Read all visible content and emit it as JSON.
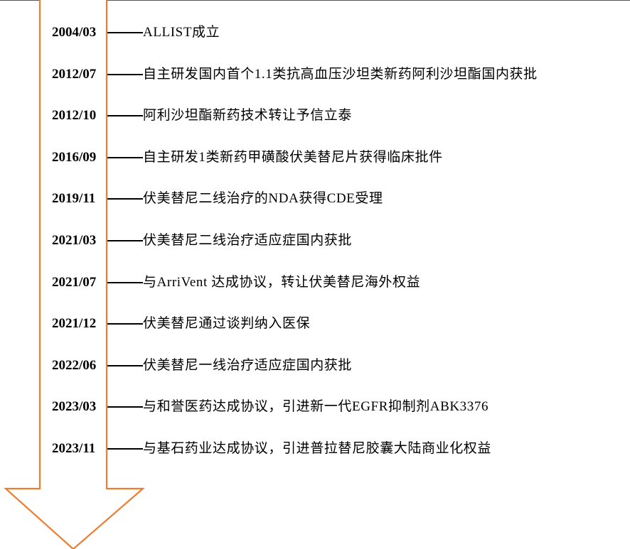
{
  "colors": {
    "arrow_stroke": "#ED7D31",
    "background": "#ffffff",
    "text": "#000000"
  },
  "timeline": {
    "events": [
      {
        "date": "2004/03",
        "description": "ALLIST成立"
      },
      {
        "date": "2012/07",
        "description": "自主研发国内首个1.1类抗高血压沙坦类新药阿利沙坦酯国内获批"
      },
      {
        "date": "2012/10",
        "description": "阿利沙坦酯新药技术转让予信立泰"
      },
      {
        "date": "2016/09",
        "description": "自主研发1类新药甲磺酸伏美替尼片获得临床批件"
      },
      {
        "date": "2019/11",
        "description": "伏美替尼二线治疗的NDA获得CDE受理"
      },
      {
        "date": "2021/03",
        "description": "伏美替尼二线治疗适应症国内获批"
      },
      {
        "date": "2021/07",
        "description": "与ArriVent 达成协议，转让伏美替尼海外权益"
      },
      {
        "date": "2021/12",
        "description": "伏美替尼通过谈判纳入医保"
      },
      {
        "date": "2022/06",
        "description": "伏美替尼一线治疗适应症国内获批"
      },
      {
        "date": "2023/03",
        "description": "与和誉医药达成协议，引进新一代EGFR抑制剂ABK3376"
      },
      {
        "date": "2023/11",
        "description": "与基石药业达成协议，引进普拉替尼胶囊大陆商业化权益"
      }
    ]
  }
}
